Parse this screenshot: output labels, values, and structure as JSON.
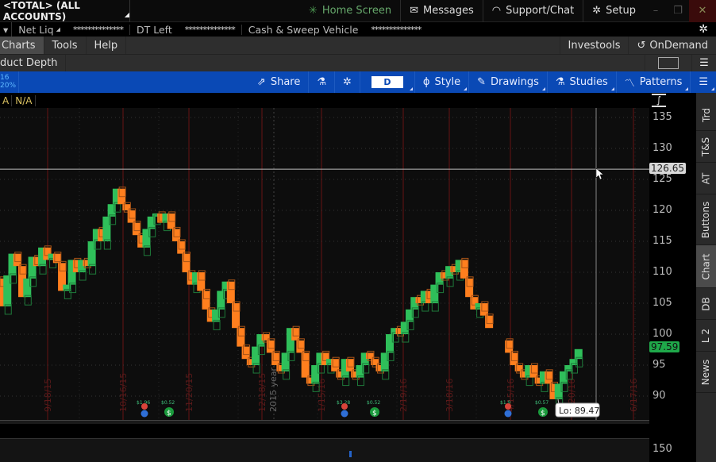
{
  "titlebar": {
    "account": "<TOTAL> (ALL ACCOUNTS)",
    "items": [
      {
        "icon": "home-screen-icon",
        "label": "Home Screen"
      },
      {
        "icon": "envelope-icon",
        "label": "Messages"
      },
      {
        "icon": "headset-icon",
        "label": "Support/Chat"
      },
      {
        "icon": "gear-icon",
        "label": "Setup"
      }
    ],
    "window_buttons": {
      "minimize": "–",
      "restore": "❐",
      "close": "✕"
    }
  },
  "account_bar": {
    "fields": [
      {
        "label": "Net Liq",
        "value": "**************"
      },
      {
        "label": "DT Left",
        "value": "**************"
      },
      {
        "label": "Cash & Sweep Vehicle",
        "value": "**************"
      }
    ]
  },
  "menubar": {
    "items": [
      "Charts",
      "Tools",
      "Help"
    ],
    "active": "Charts",
    "right_items": [
      "Investools",
      "OnDemand"
    ]
  },
  "subbar": {
    "tab": "duct Depth"
  },
  "chart_toolbar": {
    "left_info": [
      "16",
      "20%"
    ],
    "share": "Share",
    "period": "D",
    "style": "Style",
    "drawings": "Drawings",
    "studies": "Studies",
    "patterns": "Patterns"
  },
  "study_bar": {
    "values": [
      "A",
      "N/A"
    ]
  },
  "side_tabs": [
    "Trd",
    "T&S",
    "AT",
    "Buttons",
    "Chart",
    "DB",
    "L 2",
    "News"
  ],
  "side_tab_active": "Chart",
  "colors": {
    "up": "#2fbf5a",
    "down": "#ff7f1e",
    "toolbar_blue": "#0a49b5",
    "current_price_badge": "#1fa84a",
    "crosshair_badge": "#d8d8d8",
    "date_label": "#5a1a1a"
  },
  "chart_data": {
    "type": "bar",
    "style": "monkey bars (open/close blocks)",
    "title": "",
    "xlabel": "",
    "ylabel": "",
    "ylim": [
      87,
      137
    ],
    "yticks": [
      90,
      95,
      100,
      105,
      110,
      115,
      120,
      125,
      130,
      135
    ],
    "grid": true,
    "x_tick_labels": [
      "9/18/15",
      "10/16/15",
      "11/20/15",
      "12/18/15",
      "1/15/16",
      "2/19/16",
      "3/18/16",
      "4/15/16",
      "5/20/16",
      "6/17/16"
    ],
    "period_separator_label": "2015 year",
    "current_price": "97.59",
    "crosshair_price": "126.65",
    "low_label": "Lo: 89.47",
    "events": [
      {
        "type": "earnings+dividend",
        "label": "$1.96",
        "at": "10/16/15"
      },
      {
        "type": "dividend",
        "label": "$0.52",
        "at": "11/5/15"
      },
      {
        "type": "earnings+dividend",
        "label": "$3.28",
        "at": "1/26/16"
      },
      {
        "type": "dividend",
        "label": "$0.52",
        "at": "2/4/16"
      },
      {
        "type": "earnings+dividend",
        "label": "$1.9",
        "at": "4/26/16"
      },
      {
        "type": "dividend",
        "label": "$0.57",
        "at": "5/5/16"
      }
    ],
    "lower_pane_tick": "150",
    "bars": [
      {
        "o": 109,
        "c": 104.5
      },
      {
        "o": 104.5,
        "c": 109.5
      },
      {
        "o": 109.5,
        "c": 113
      },
      {
        "o": 113,
        "c": 111
      },
      {
        "o": 111,
        "c": 106
      },
      {
        "o": 106,
        "c": 109
      },
      {
        "o": 109,
        "c": 112.5
      },
      {
        "o": 112.5,
        "c": 111
      },
      {
        "o": 111,
        "c": 114
      },
      {
        "o": 114,
        "c": 112
      },
      {
        "o": 112,
        "c": 113
      },
      {
        "o": 113,
        "c": 111.5
      },
      {
        "o": 111.5,
        "c": 107
      },
      {
        "o": 107,
        "c": 108
      },
      {
        "o": 108,
        "c": 112
      },
      {
        "o": 112,
        "c": 110
      },
      {
        "o": 110,
        "c": 112
      },
      {
        "o": 112,
        "c": 111
      },
      {
        "o": 111,
        "c": 115
      },
      {
        "o": 115,
        "c": 117
      },
      {
        "o": 117,
        "c": 115
      },
      {
        "o": 115,
        "c": 119
      },
      {
        "o": 119,
        "c": 121
      },
      {
        "o": 121,
        "c": 123.5
      },
      {
        "o": 123.5,
        "c": 121
      },
      {
        "o": 121,
        "c": 120
      },
      {
        "o": 120,
        "c": 118
      },
      {
        "o": 118,
        "c": 116
      },
      {
        "o": 116,
        "c": 114
      },
      {
        "o": 114,
        "c": 117
      },
      {
        "o": 117,
        "c": 119
      },
      {
        "o": 119,
        "c": 119.5
      },
      {
        "o": 119.5,
        "c": 118
      },
      {
        "o": 118,
        "c": 119.5
      },
      {
        "o": 119.5,
        "c": 117
      },
      {
        "o": 117,
        "c": 115
      },
      {
        "o": 115,
        "c": 113
      },
      {
        "o": 113,
        "c": 110
      },
      {
        "o": 110,
        "c": 108
      },
      {
        "o": 108,
        "c": 110
      },
      {
        "o": 110,
        "c": 107
      },
      {
        "o": 107,
        "c": 104
      },
      {
        "o": 104,
        "c": 102
      },
      {
        "o": 102,
        "c": 104
      },
      {
        "o": 104,
        "c": 107
      },
      {
        "o": 107,
        "c": 108.5
      },
      {
        "o": 108.5,
        "c": 105
      },
      {
        "o": 105,
        "c": 101
      },
      {
        "o": 101,
        "c": 98
      },
      {
        "o": 98,
        "c": 96
      },
      {
        "o": 96,
        "c": 95
      },
      {
        "o": 95,
        "c": 98
      },
      {
        "o": 98,
        "c": 100
      },
      {
        "o": 100,
        "c": 99
      },
      {
        "o": 99,
        "c": 97
      },
      {
        "o": 97,
        "c": 95
      },
      {
        "o": 95,
        "c": 94
      },
      {
        "o": 94,
        "c": 97
      },
      {
        "o": 97,
        "c": 101
      },
      {
        "o": 101,
        "c": 99
      },
      {
        "o": 99,
        "c": 97
      },
      {
        "o": 97,
        "c": 93
      },
      {
        "o": 93,
        "c": 92
      },
      {
        "o": 92,
        "c": 95
      },
      {
        "o": 95,
        "c": 97
      },
      {
        "o": 97,
        "c": 95
      },
      {
        "o": 95,
        "c": 96
      },
      {
        "o": 96,
        "c": 94
      },
      {
        "o": 94,
        "c": 93
      },
      {
        "o": 93,
        "c": 96
      },
      {
        "o": 96,
        "c": 94
      },
      {
        "o": 94,
        "c": 93
      },
      {
        "o": 93,
        "c": 95
      },
      {
        "o": 95,
        "c": 97
      },
      {
        "o": 97,
        "c": 96
      },
      {
        "o": 96,
        "c": 95
      },
      {
        "o": 95,
        "c": 94
      },
      {
        "o": 94,
        "c": 97
      },
      {
        "o": 97,
        "c": 100
      },
      {
        "o": 100,
        "c": 101
      },
      {
        "o": 101,
        "c": 100
      },
      {
        "o": 100,
        "c": 102
      },
      {
        "o": 102,
        "c": 104
      },
      {
        "o": 104,
        "c": 106
      },
      {
        "o": 106,
        "c": 105
      },
      {
        "o": 105,
        "c": 107
      },
      {
        "o": 107,
        "c": 105
      },
      {
        "o": 105,
        "c": 108
      },
      {
        "o": 108,
        "c": 110
      },
      {
        "o": 110,
        "c": 109
      },
      {
        "o": 109,
        "c": 111
      },
      {
        "o": 111,
        "c": 110
      },
      {
        "o": 110,
        "c": 112
      },
      {
        "o": 112,
        "c": 109
      },
      {
        "o": 109,
        "c": 106
      },
      {
        "o": 106,
        "c": 104
      },
      {
        "o": 104,
        "c": 105
      },
      {
        "o": 105,
        "c": 103
      },
      {
        "o": 103,
        "c": 101
      },
      {
        "o": 99,
        "c": 97
      },
      {
        "o": 97,
        "c": 95
      },
      {
        "o": 95,
        "c": 94
      },
      {
        "o": 94,
        "c": 93
      },
      {
        "o": 93,
        "c": 95
      },
      {
        "o": 95,
        "c": 93
      },
      {
        "o": 93,
        "c": 92
      },
      {
        "o": 92,
        "c": 94
      },
      {
        "o": 94,
        "c": 92
      },
      {
        "o": 92,
        "c": 89.5
      },
      {
        "o": 89.5,
        "c": 92
      },
      {
        "o": 92,
        "c": 94
      },
      {
        "o": 94,
        "c": 95
      },
      {
        "o": 95,
        "c": 96
      },
      {
        "o": 96,
        "c": 97.59
      }
    ]
  }
}
